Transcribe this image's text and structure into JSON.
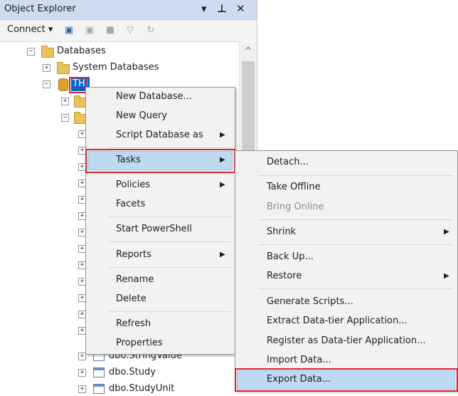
{
  "panel": {
    "title": "Object Explorer",
    "pin_glyph": "▾ ⊥",
    "close_glyph": "✕"
  },
  "toolbar": {
    "connect_label": "Connect ▾",
    "icons": [
      "connect-icon",
      "disconnect-icon",
      "stop-icon",
      "filter-icon",
      "refresh-icon"
    ]
  },
  "tree": {
    "databases": "Databases",
    "system_databases": "System Databases",
    "selected_db": "THI",
    "tables": [
      "dbo.StringValue",
      "dbo.Study",
      "dbo.StudyUnit"
    ]
  },
  "context_menu": {
    "items": {
      "new_database": "New Database...",
      "new_query": "New Query",
      "script_database_as": "Script Database as",
      "tasks": "Tasks",
      "policies": "Policies",
      "facets": "Facets",
      "start_powershell": "Start PowerShell",
      "reports": "Reports",
      "rename": "Rename",
      "delete": "Delete",
      "refresh": "Refresh",
      "properties": "Properties"
    },
    "arrow": "▶"
  },
  "tasks_menu": {
    "items": {
      "detach": "Detach...",
      "take_offline": "Take Offline",
      "bring_online": "Bring Online",
      "shrink": "Shrink",
      "back_up": "Back Up...",
      "restore": "Restore",
      "generate_scripts": "Generate Scripts...",
      "extract_data_tier": "Extract Data-tier Application...",
      "register_data_tier": "Register as Data-tier Application...",
      "import_data": "Import Data...",
      "export_data": "Export Data..."
    },
    "arrow": "▶"
  },
  "colors": {
    "highlight": "#bfd9f3",
    "annotation_red": "#d92330",
    "selection_blue": "#0a64c8"
  }
}
